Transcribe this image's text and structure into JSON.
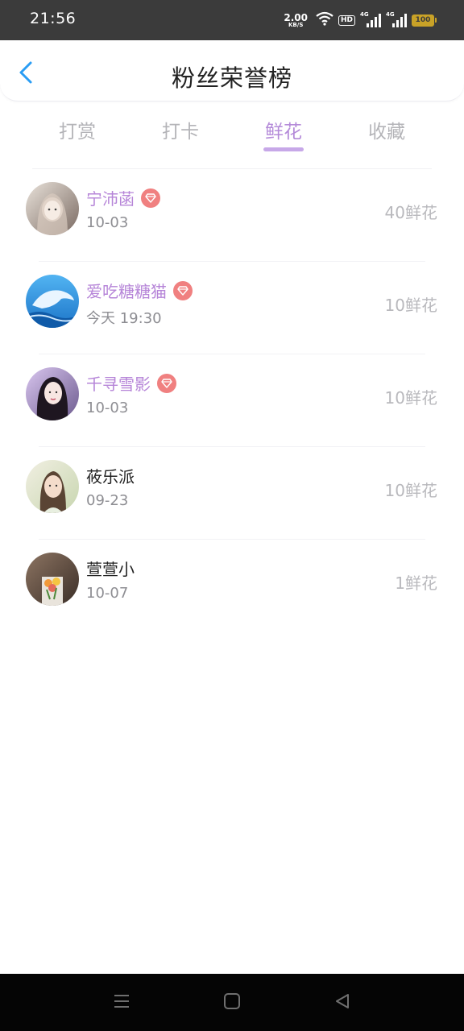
{
  "status_bar": {
    "time": "21:56",
    "net_speed_value": "2.00",
    "net_speed_unit": "KB/S",
    "hd_label": "HD",
    "signal1_label": "4G",
    "signal2_label": "4G",
    "battery": "100"
  },
  "header": {
    "title": "粉丝荣誉榜",
    "back_icon": "chevron-left-icon"
  },
  "tabs": [
    {
      "label": "打赏",
      "active": false
    },
    {
      "label": "打卡",
      "active": false
    },
    {
      "label": "鲜花",
      "active": true
    },
    {
      "label": "收藏",
      "active": false
    }
  ],
  "fans": [
    {
      "name": "宁沛菡",
      "date": "10-03",
      "amount": "40鲜花",
      "vip": true
    },
    {
      "name": "爱吃糖糖猫",
      "date": "今天 19:30",
      "amount": "10鲜花",
      "vip": true
    },
    {
      "name": "千寻雪影",
      "date": "10-03",
      "amount": "10鲜花",
      "vip": true
    },
    {
      "name": "莜乐派",
      "date": "09-23",
      "amount": "10鲜花",
      "vip": false
    },
    {
      "name": "萱萱小",
      "date": "10-07",
      "amount": "1鲜花",
      "vip": false
    }
  ],
  "colors": {
    "accent": "#b48ad9",
    "vip_badge": "#f08080",
    "back_arrow": "#2a9df4"
  },
  "nav_bar": {
    "icons": [
      "menu-icon",
      "home-icon",
      "back-triangle-icon"
    ]
  }
}
